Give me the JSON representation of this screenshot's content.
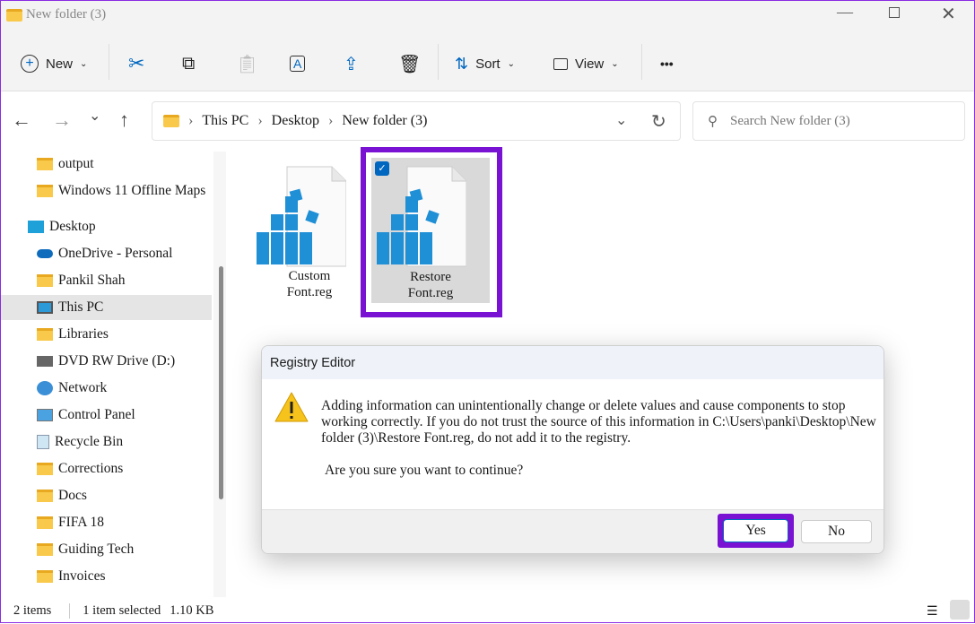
{
  "window": {
    "title": "New folder (3)"
  },
  "toolbar": {
    "new_label": "New",
    "sort_label": "Sort",
    "view_label": "View",
    "more": "•••"
  },
  "address": {
    "crumbs": [
      "This PC",
      "Desktop",
      "New folder (3)"
    ],
    "sep": "›"
  },
  "search": {
    "placeholder": "Search New folder (3)"
  },
  "sidebar": {
    "items": [
      {
        "label": "output",
        "icon": "folder-icon"
      },
      {
        "label": "Windows 11 Offline Maps",
        "icon": "folder-icon"
      },
      {
        "label": "Desktop",
        "icon": "desktop-icon"
      },
      {
        "label": "OneDrive - Personal",
        "icon": "onedrive-icon"
      },
      {
        "label": "Pankil Shah",
        "icon": "folder-icon"
      },
      {
        "label": "This PC",
        "icon": "pc-icon"
      },
      {
        "label": "Libraries",
        "icon": "folder-icon"
      },
      {
        "label": "DVD RW Drive (D:)",
        "icon": "dvd-icon"
      },
      {
        "label": "Network",
        "icon": "network-icon"
      },
      {
        "label": "Control Panel",
        "icon": "control-panel-icon"
      },
      {
        "label": "Recycle Bin",
        "icon": "recycle-bin-icon"
      },
      {
        "label": "Corrections",
        "icon": "folder-icon"
      },
      {
        "label": "Docs",
        "icon": "folder-icon"
      },
      {
        "label": "FIFA 18",
        "icon": "folder-icon"
      },
      {
        "label": "Guiding Tech",
        "icon": "folder-icon"
      },
      {
        "label": "Invoices",
        "icon": "folder-icon"
      }
    ]
  },
  "files": [
    {
      "line1": "Custom",
      "line2": "Font.reg"
    },
    {
      "line1": "Restore",
      "line2": "Font.reg"
    }
  ],
  "status": {
    "items": "2 items",
    "selected": "1 item selected",
    "size": "1.10 KB"
  },
  "dialog": {
    "title": "Registry Editor",
    "message": "Adding information can unintentionally change or delete values and cause components to stop working correctly. If you do not trust the source of this information in C:\\Users\\panki\\Desktop\\New folder (3)\\Restore Font.reg, do not add it to the registry.",
    "question": "Are you sure you want to continue?",
    "yes": "Yes",
    "no": "No"
  },
  "colors": {
    "highlight": "#7a12d4",
    "accent": "#0067c0"
  }
}
